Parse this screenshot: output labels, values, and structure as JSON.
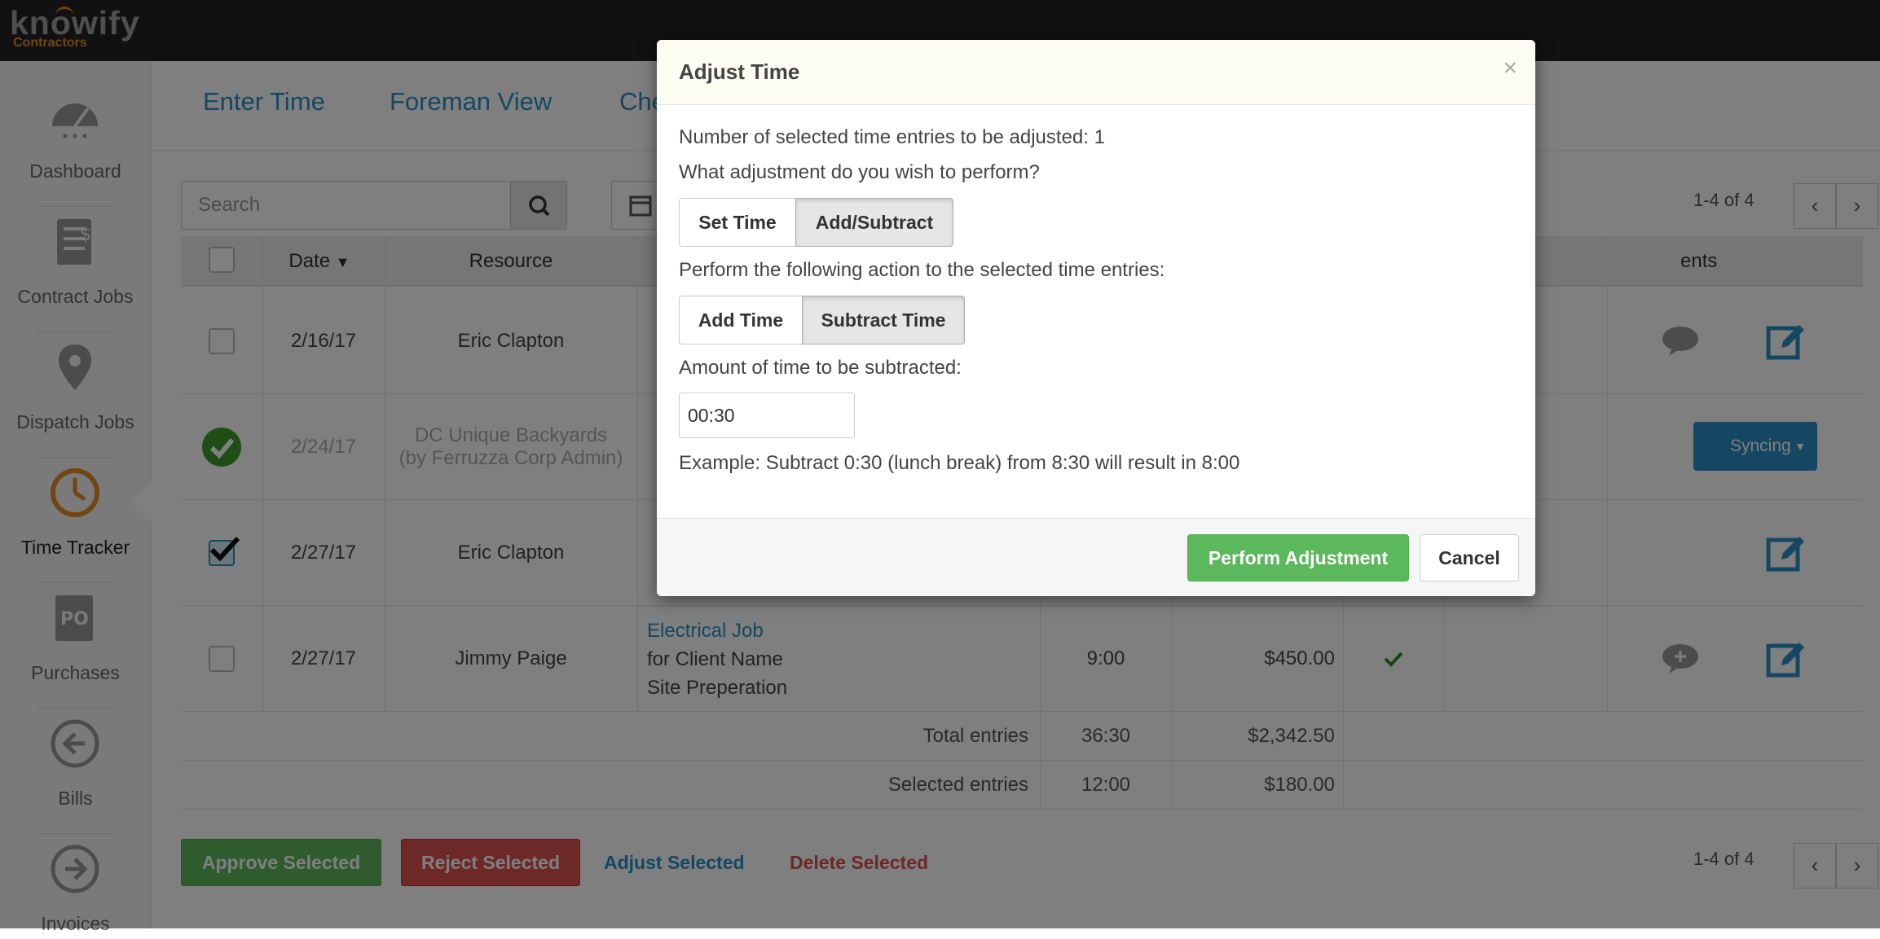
{
  "app": {
    "logo_text": "knowify",
    "logo_sub": "Contractors"
  },
  "sidebar": {
    "items": [
      {
        "label": "Dashboard",
        "icon": "gauge-icon"
      },
      {
        "label": "Contract Jobs",
        "icon": "document-dollar-icon"
      },
      {
        "label": "Dispatch Jobs",
        "icon": "map-pin-icon"
      },
      {
        "label": "Time Tracker",
        "icon": "clock-icon"
      },
      {
        "label": "Purchases",
        "icon": "po-document-icon"
      },
      {
        "label": "Bills",
        "icon": "arrow-left-circle-icon"
      },
      {
        "label": "Invoices",
        "icon": "arrow-right-circle-icon"
      }
    ]
  },
  "tabs": [
    "Enter Time",
    "Foreman View",
    "Che"
  ],
  "search": {
    "placeholder": "Search"
  },
  "pager": {
    "label": "1-4 of 4"
  },
  "table": {
    "headers": {
      "date": "Date",
      "resource": "Resource",
      "comments": "ents"
    },
    "rows": [
      {
        "date": "2/16/17",
        "resource": "Eric Clapton"
      },
      {
        "date": "2/24/17",
        "resource_line1": "DC Unique Backyards",
        "resource_line2": "(by Ferruzza Corp Admin)",
        "action_label": "Syncing"
      },
      {
        "date": "2/27/17",
        "resource": "Eric Clapton"
      },
      {
        "date": "2/27/17",
        "resource": "Jimmy Paige",
        "job_link": "Electrical Job",
        "job_client": "for Client Name",
        "job_task": "Site Preperation",
        "hours": "9:00",
        "amount": "$450.00"
      }
    ],
    "totals": {
      "total_label": "Total entries",
      "total_hours": "36:30",
      "total_amount": "$2,342.50",
      "selected_label": "Selected entries",
      "selected_hours": "12:00",
      "selected_amount": "$180.00"
    }
  },
  "actions": {
    "approve": "Approve Selected",
    "reject": "Reject Selected",
    "adjust": "Adjust Selected",
    "delete": "Delete Selected"
  },
  "modal": {
    "title": "Adjust Time",
    "close": "×",
    "count_text": "Number of selected time entries to be adjusted: 1",
    "question": "What adjustment do you wish to perform?",
    "mode_options": [
      "Set Time",
      "Add/Subtract"
    ],
    "action_prompt": "Perform the following action to the selected time entries:",
    "action_options": [
      "Add Time",
      "Subtract Time"
    ],
    "amount_label": "Amount of time to be subtracted:",
    "amount_value": "00:30",
    "example": "Example: Subtract 0:30 (lunch break) from 8:30 will result in 8:00",
    "perform_button": "Perform Adjustment",
    "cancel_button": "Cancel"
  },
  "colors": {
    "brand_orange": "#e58a24",
    "link_blue": "#2b8ec6",
    "success_green": "#5cb85c",
    "danger_red": "#d9534f"
  }
}
